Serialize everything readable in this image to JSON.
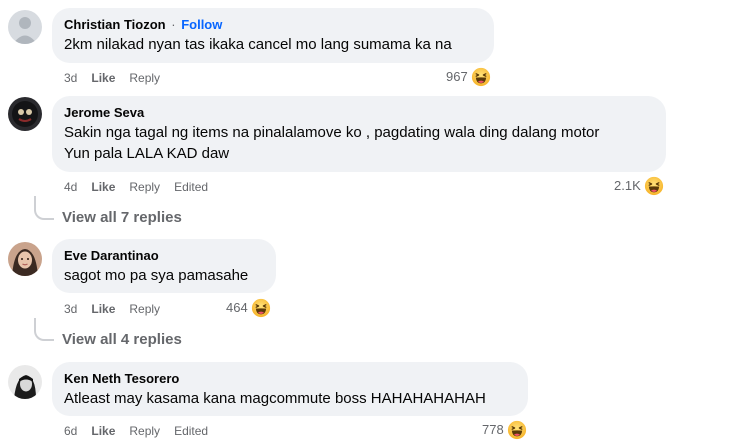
{
  "comments": [
    {
      "author": "Christian Tiozon",
      "follow": "Follow",
      "separator": "·",
      "lines": [
        "2km nilakad nyan tas ikaka cancel mo lang sumama ka na"
      ],
      "time": "3d",
      "like": "Like",
      "reply": "Reply",
      "reaction_count": "967",
      "reaction_icon": "haha-icon"
    },
    {
      "author": "Jerome Seva",
      "lines": [
        "Sakin nga tagal ng items na pinalalamove ko , pagdating wala ding dalang motor",
        "Yun pala LALA KAD daw"
      ],
      "time": "4d",
      "like": "Like",
      "reply": "Reply",
      "edited": "Edited",
      "reaction_count": "2.1K",
      "reaction_icon": "haha-icon",
      "view_replies": "View all 7 replies"
    },
    {
      "author": "Eve Darantinao",
      "lines": [
        "sagot mo pa sya pamasahe"
      ],
      "time": "3d",
      "like": "Like",
      "reply": "Reply",
      "reaction_count": "464",
      "reaction_icon": "haha-icon",
      "view_replies": "View all 4 replies"
    },
    {
      "author": "Ken Neth Tesorero",
      "lines": [
        "Atleast may kasama kana magcommute boss HAHAHAHAHAH"
      ],
      "time": "6d",
      "like": "Like",
      "reply": "Reply",
      "edited": "Edited",
      "reaction_count": "778",
      "reaction_icon": "haha-icon"
    }
  ],
  "colors": {
    "bubble": "#f0f2f5",
    "meta": "#65676b",
    "follow": "#0866ff",
    "thread_line": "#ced0d4"
  }
}
